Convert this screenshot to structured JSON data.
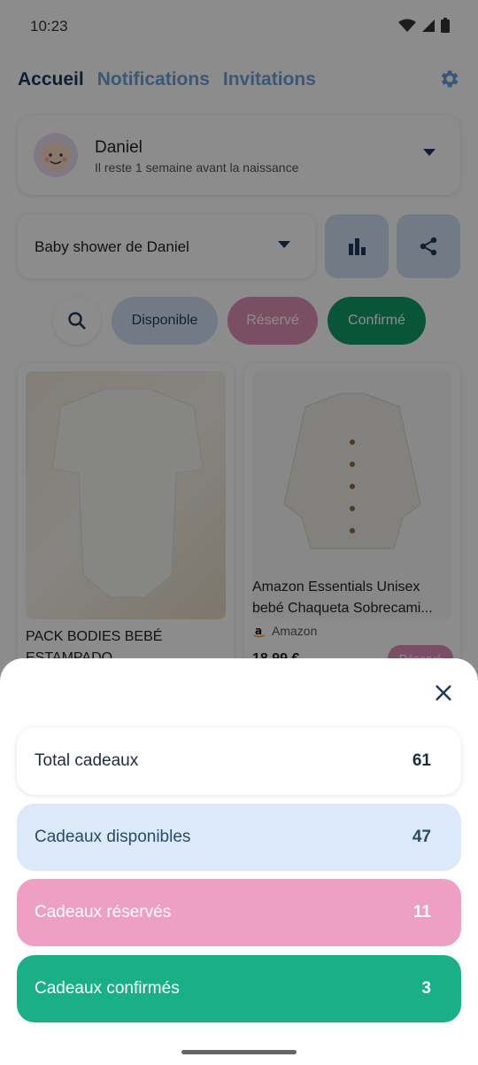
{
  "status_bar": {
    "time": "10:23"
  },
  "header": {
    "tabs": [
      {
        "label": "Accueil"
      },
      {
        "label": "Notifications"
      },
      {
        "label": "Invitations"
      }
    ]
  },
  "profile": {
    "name": "Daniel",
    "subtitle": "Il reste 1 semaine avant la naissance"
  },
  "event": {
    "selected": "Baby shower de Daniel"
  },
  "filters": {
    "chips": [
      "Disponible",
      "Réservé",
      "Confirmé"
    ]
  },
  "products": [
    {
      "title": "PACK BODIES BEBÉ ESTAMPADO",
      "brand": "",
      "price": "",
      "status": ""
    },
    {
      "title": "Amazon Essentials Unisex bebé Chaqueta Sobrecami...",
      "brand": "Amazon",
      "price": "18,99 €",
      "status": "Réservé"
    }
  ],
  "stats": {
    "total": {
      "label": "Total cadeaux",
      "value": "61"
    },
    "disponibles": {
      "label": "Cadeaux disponibles",
      "value": "47"
    },
    "reserves": {
      "label": "Cadeaux réservés",
      "value": "11"
    },
    "confirmes": {
      "label": "Cadeaux confirmés",
      "value": "3"
    }
  },
  "icons": [
    "wifi-icon",
    "signal-icon",
    "battery-icon",
    "gear-icon",
    "chevron-down-icon",
    "bar-chart-icon",
    "share-icon",
    "search-icon",
    "close-icon"
  ],
  "colors": {
    "primary": "#1a3a5c",
    "accent_blue": "#6aa1d8",
    "available": "#dbe9fb",
    "reserved": "#ee9fc4",
    "confirmed": "#1ab087"
  }
}
